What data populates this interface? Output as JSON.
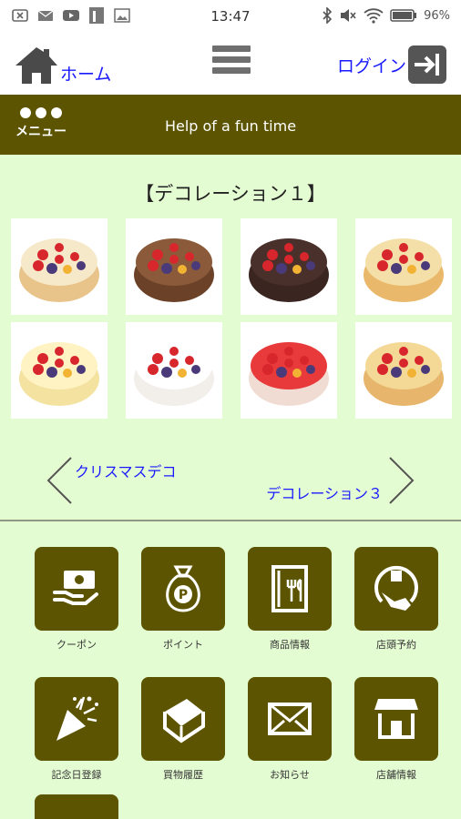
{
  "status_bar": {
    "time": "13:47",
    "battery": "96%",
    "left_icons": [
      "close-box-icon",
      "mail-icon",
      "youtube-icon",
      "app-icon",
      "image-icon"
    ],
    "right_icons": [
      "bluetooth-icon",
      "mute-icon",
      "wifi-icon",
      "battery-icon"
    ]
  },
  "header": {
    "home_label": "ホーム",
    "login_label": "ログイン"
  },
  "menubar": {
    "menu_label": "メニュー",
    "title": "Help of a fun time"
  },
  "gallery": {
    "title": "【デコレーション１】",
    "items": [
      {
        "name": "cake-1",
        "base": "#e8c48a",
        "top": "#f6e9c9"
      },
      {
        "name": "cake-2",
        "base": "#6b4128",
        "top": "#8a5a3a"
      },
      {
        "name": "cake-3",
        "base": "#3a2520",
        "top": "#4a302a"
      },
      {
        "name": "cake-4",
        "base": "#e9b86a",
        "top": "#f4dfa8"
      },
      {
        "name": "cake-5",
        "base": "#f3e2a0",
        "top": "#fff3c4"
      },
      {
        "name": "cake-6",
        "base": "#f2eeea",
        "top": "#ffffff"
      },
      {
        "name": "cake-7",
        "base": "#f1dcd4",
        "top": "#e83a3a"
      },
      {
        "name": "cake-8",
        "base": "#e7b56c",
        "top": "#f3d896"
      }
    ]
  },
  "pager": {
    "prev_label": "クリスマスデコ",
    "next_label": "デコレーション３"
  },
  "tiles": [
    {
      "label": "クーポン",
      "icon": "coupon-icon"
    },
    {
      "label": "ポイント",
      "icon": "point-bag-icon"
    },
    {
      "label": "商品情報",
      "icon": "menu-book-icon"
    },
    {
      "label": "店頭予約",
      "icon": "reservation-icon"
    },
    {
      "label": "記念日登録",
      "icon": "party-popper-icon"
    },
    {
      "label": "買物履歴",
      "icon": "history-book-icon"
    },
    {
      "label": "お知らせ",
      "icon": "mail-icon"
    },
    {
      "label": "店舗情報",
      "icon": "shop-icon"
    }
  ],
  "colors": {
    "accent": "#5c5400",
    "background": "#e4fcd2",
    "link": "#1a1aff"
  }
}
